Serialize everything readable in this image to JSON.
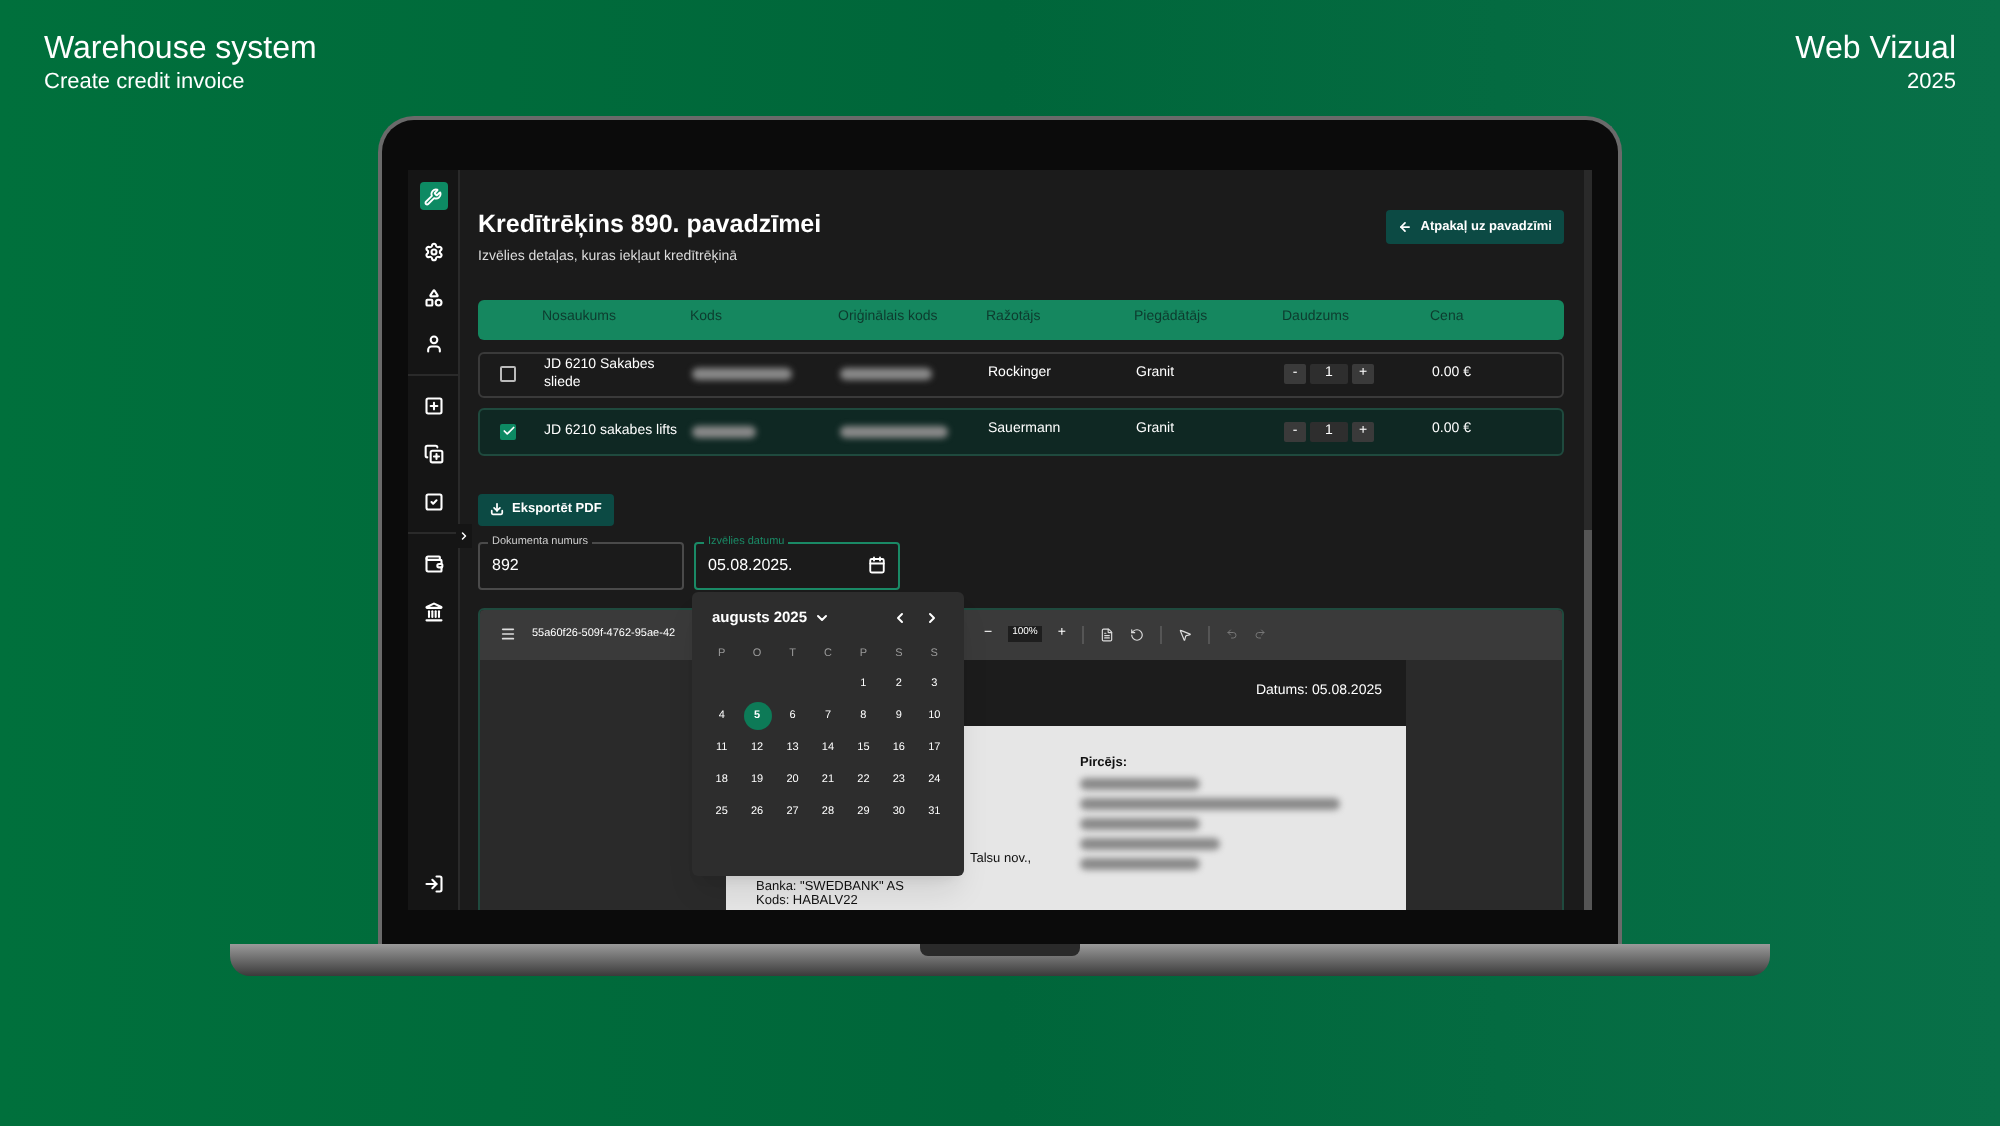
{
  "header": {
    "title": "Warehouse system",
    "subtitle": "Create credit invoice",
    "brand": "Web Vizual",
    "year": "2025"
  },
  "page": {
    "title": "Kredītrēķins 890. pavadzīmei",
    "subtitle": "Izvēlies detaļas, kuras iekļaut kredītrēķinā",
    "back_button": "Atpakaļ uz pavadzīmi"
  },
  "table": {
    "columns": [
      "Nosaukums",
      "Kods",
      "Oriģinālais kods",
      "Ražotājs",
      "Piegādātājs",
      "Daudzums",
      "Cena"
    ],
    "rows": [
      {
        "name": "JD 6210 Sakabes sliede",
        "selected": false,
        "manufacturer": "Rockinger",
        "supplier": "Granit",
        "decrement": "-",
        "quantity": "1",
        "increment": "+",
        "price": "0.00 €"
      },
      {
        "name": "JD 6210 sakabes lifts",
        "selected": true,
        "manufacturer": "Sauermann",
        "supplier": "Granit",
        "decrement": "-",
        "quantity": "1",
        "increment": "+",
        "price": "0.00 €"
      }
    ]
  },
  "export_button": "Eksportēt PDF",
  "fields": [
    {
      "label": "Dokumenta numurs",
      "value": "892",
      "focused": false
    },
    {
      "label": "Izvēlies datumu",
      "value": "05.08.2025.",
      "focused": true
    }
  ],
  "calendar": {
    "month": "augusts 2025",
    "weekdays": [
      "P",
      "O",
      "T",
      "C",
      "P",
      "S",
      "S"
    ],
    "weeks": [
      [
        {
          "day": "1",
          "selected": false
        },
        {
          "day": "2",
          "selected": false
        },
        {
          "day": "3",
          "selected": false
        }
      ],
      [
        {
          "day": "4",
          "selected": false
        },
        {
          "day": "5",
          "selected": true
        },
        {
          "day": "6",
          "selected": false
        },
        {
          "day": "7",
          "selected": false
        },
        {
          "day": "8",
          "selected": false
        },
        {
          "day": "9",
          "selected": false
        },
        {
          "day": "10",
          "selected": false
        }
      ],
      [
        {
          "day": "11",
          "selected": false
        },
        {
          "day": "12",
          "selected": false
        },
        {
          "day": "13",
          "selected": false
        },
        {
          "day": "14",
          "selected": false
        },
        {
          "day": "15",
          "selected": false
        },
        {
          "day": "16",
          "selected": false
        },
        {
          "day": "17",
          "selected": false
        }
      ],
      [
        {
          "day": "18",
          "selected": false
        },
        {
          "day": "19",
          "selected": false
        },
        {
          "day": "20",
          "selected": false
        },
        {
          "day": "21",
          "selected": false
        },
        {
          "day": "22",
          "selected": false
        },
        {
          "day": "23",
          "selected": false
        },
        {
          "day": "24",
          "selected": false
        }
      ],
      [
        {
          "day": "25",
          "selected": false
        },
        {
          "day": "26",
          "selected": false
        },
        {
          "day": "27",
          "selected": false
        },
        {
          "day": "28",
          "selected": false
        },
        {
          "day": "29",
          "selected": false
        },
        {
          "day": "30",
          "selected": false
        },
        {
          "day": "31",
          "selected": false
        }
      ]
    ]
  },
  "viewer": {
    "file": "55a60f26-509f-4762-95ae-42",
    "zoom_out": "−",
    "zoom": "100%",
    "zoom_in": "+",
    "date": "Datums: 05.08.2025",
    "address_tail": "Talsu nov.,",
    "bank": "Banka: \"SWEDBANK\" AS",
    "code": "Kods: HABALV22",
    "buyer_label": "Pircējs:"
  }
}
